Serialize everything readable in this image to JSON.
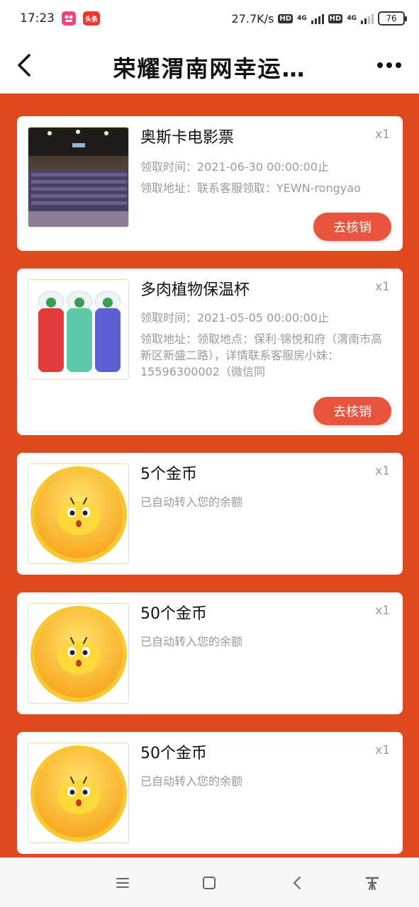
{
  "status_bar": {
    "time": "17:23",
    "app_badge_a": "",
    "app_badge_b": "头条",
    "net_speed": "27.7K/s",
    "hd": "HD",
    "signal": "4G",
    "battery": "76"
  },
  "header": {
    "title": "荣耀渭南网幸运…",
    "back_icon": "chevron-left-icon",
    "more_icon": "more-dots-icon"
  },
  "colors": {
    "background_accent": "#de4a1d",
    "button": "#e8543c"
  },
  "prizes": [
    {
      "name": "奥斯卡电影票",
      "qty": "x1",
      "time_line": "领取时间：2021-06-30 00:00:00止",
      "address_line": "领取地址：联系客服领取：YEWN-rongyao",
      "button": "去核销"
    },
    {
      "name": "多肉植物保温杯",
      "qty": "x1",
      "time_line": "领取时间：2021-05-05 00:00:00止",
      "address_line": "领取地址：领取地点：保利·锦悦和府（渭南市高新区新盛二路），详情联系客服房小妹：15596300002（微信同",
      "button": "去核销"
    },
    {
      "name": "5个金币",
      "qty": "x1",
      "note": "已自动转入您的余额"
    },
    {
      "name": "50个金币",
      "qty": "x1",
      "note": "已自动转入您的余额"
    },
    {
      "name": "50个金币",
      "qty": "x1",
      "note": "已自动转入您的余额"
    }
  ],
  "nav": {
    "menu_icon": "menu-icon",
    "home_icon": "square-home-icon",
    "back_icon": "triangle-back-icon",
    "accessibility_icon": "accessibility-icon"
  }
}
